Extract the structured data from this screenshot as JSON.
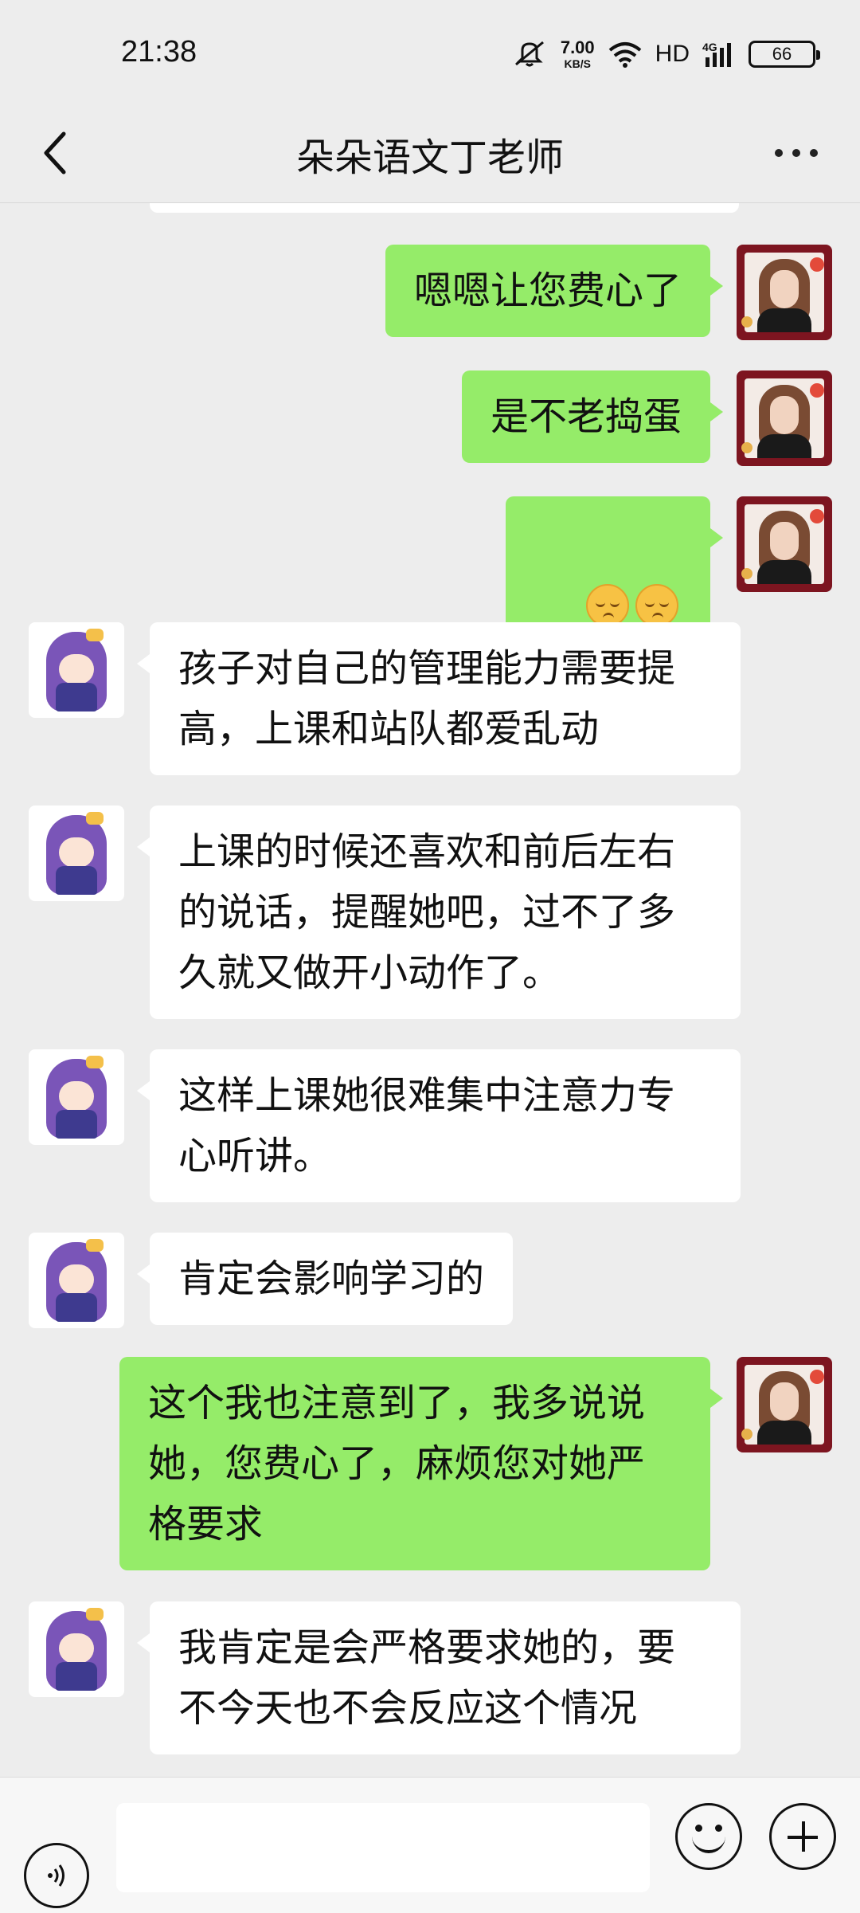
{
  "status_bar": {
    "time": "21:38",
    "net_speed_value": "7.00",
    "net_speed_unit": "KB/S",
    "network": "HD",
    "signal_label": "4G",
    "battery": "66",
    "icons": [
      "mute-icon",
      "wifi-icon",
      "signal-icon",
      "battery-icon"
    ]
  },
  "header": {
    "title": "朵朵语文丁老师",
    "back_icon": "chevron-left-icon",
    "more_icon": "more-dots-icon"
  },
  "messages": [
    {
      "sender": "self",
      "text": "嗯嗯让您费心了"
    },
    {
      "sender": "self",
      "text": "是不老捣蛋"
    },
    {
      "sender": "self",
      "text": "",
      "emoji": [
        "dizzy-face-emoji",
        "dizzy-face-emoji"
      ]
    },
    {
      "sender": "other",
      "text": "孩子对自己的管理能力需要提高，上课和站队都爱乱动"
    },
    {
      "sender": "other",
      "text": "上课的时候还喜欢和前后左右的说话，提醒她吧，过不了多久就又做开小动作了。"
    },
    {
      "sender": "other",
      "text": "这样上课她很难集中注意力专心听讲。"
    },
    {
      "sender": "other",
      "text": "肯定会影响学习的"
    },
    {
      "sender": "self",
      "text": "这个我也注意到了，我多说说她，您费心了，麻烦您对她严格要求"
    },
    {
      "sender": "other",
      "text": "我肯定是会严格要求她的，要不今天也不会反应这个情况"
    }
  ],
  "input_bar": {
    "voice_icon": "voice-icon",
    "input_value": "",
    "emoji_icon": "emoji-icon",
    "plus_icon": "plus-icon"
  },
  "colors": {
    "background": "#ededed",
    "self_bubble": "#95ec69",
    "other_bubble": "#ffffff"
  }
}
